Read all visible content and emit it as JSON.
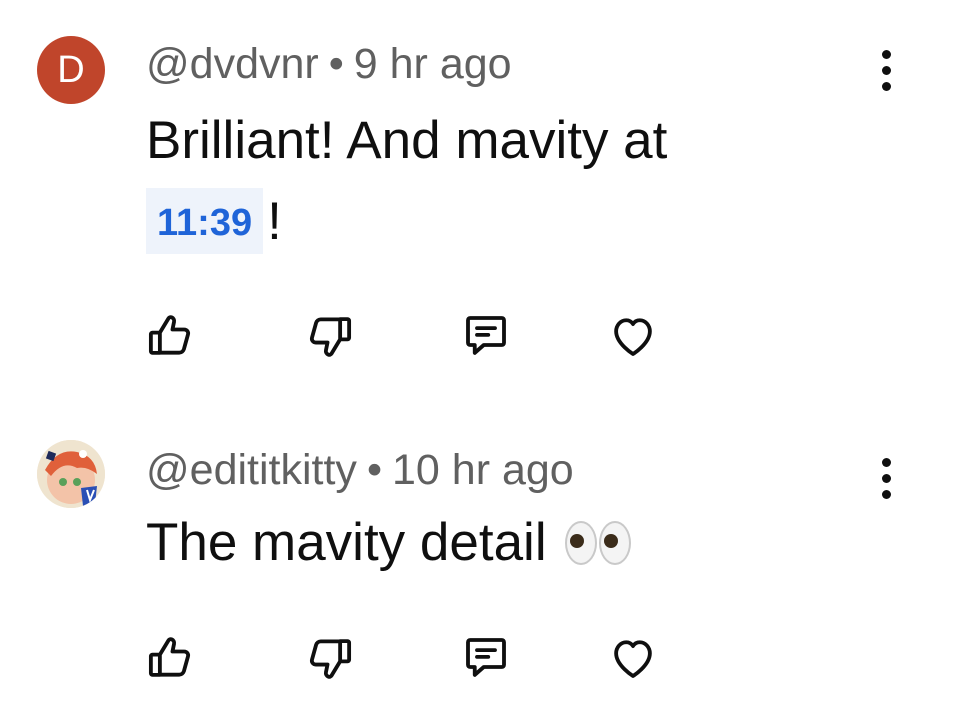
{
  "comments": [
    {
      "avatar_letter": "D",
      "avatar_color": "#c0452b",
      "username": "@dvdvnr",
      "separator": "•",
      "time": "9 hr ago",
      "text_line1": "Brilliant! And mavity at",
      "timestamp_link": "11:39",
      "text_after_link": "!",
      "icons": [
        "like-icon",
        "dislike-icon",
        "reply-icon",
        "heart-icon",
        "more-vertical-icon"
      ]
    },
    {
      "username": "@edititkitty",
      "separator": "•",
      "time": "10 hr ago",
      "text": "The mavity detail",
      "emoji": "eyes",
      "icons": [
        "like-icon",
        "dislike-icon",
        "reply-icon",
        "heart-icon",
        "more-vertical-icon"
      ]
    }
  ],
  "colors": {
    "link_blue": "#1f64d8",
    "link_bg": "#eef3fb",
    "meta_gray": "#606060",
    "text": "#0f0f0f"
  }
}
